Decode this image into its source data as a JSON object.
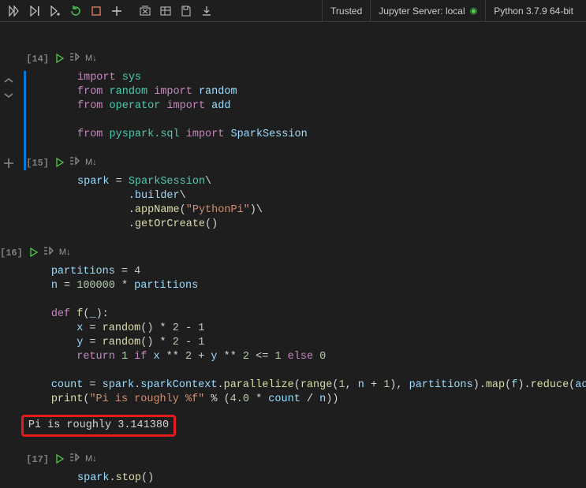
{
  "toolbar": {
    "trusted": "Trusted",
    "server": "Jupyter Server: local",
    "kernel": "Python 3.7.9 64-bit"
  },
  "cells": [
    {
      "prompt": "[14]",
      "code_html": "<span class='kw'>import</span> <span class='mod'>sys</span>\n<span class='kw'>from</span> <span class='mod'>random</span> <span class='kw'>import</span> <span class='id'>random</span>\n<span class='kw'>from</span> <span class='mod'>operator</span> <span class='kw'>import</span> <span class='id'>add</span>\n\n<span class='kw'>from</span> <span class='mod'>pyspark.sql</span> <span class='kw'>import</span> <span class='id'>SparkSession</span>",
      "markdown_label": "M↓"
    },
    {
      "prompt": "[15]",
      "code_html": "<span class='id'>spark</span> = <span class='mod'>SparkSession</span>\\\n        .<span class='id'>builder</span>\\\n        .<span class='fn'>appName</span>(<span class='str'>\"PythonPi\"</span>)\\\n        .<span class='fn'>getOrCreate</span>()",
      "markdown_label": "M↓"
    },
    {
      "prompt": "[16]",
      "code_html": "<span class='id'>partitions</span> = <span class='num'>4</span>\n<span class='id'>n</span> = <span class='num'>100000</span> * <span class='id'>partitions</span>\n\n<span class='kw'>def</span> <span class='fn'>f</span>(<span class='id'>_</span>):\n    <span class='id'>x</span> = <span class='fn'>random</span>() * <span class='num'>2</span> - <span class='num'>1</span>\n    <span class='id'>y</span> = <span class='fn'>random</span>() * <span class='num'>2</span> - <span class='num'>1</span>\n    <span class='kw'>return</span> <span class='num'>1</span> <span class='kw'>if</span> <span class='id'>x</span> ** <span class='num'>2</span> + <span class='id'>y</span> ** <span class='num'>2</span> &lt;= <span class='num'>1</span> <span class='kw'>else</span> <span class='num'>0</span>\n\n<span class='id'>count</span> = <span class='id'>spark</span>.<span class='id'>sparkContext</span>.<span class='fn'>parallelize</span>(<span class='fn'>range</span>(<span class='num'>1</span>, <span class='id'>n</span> + <span class='num'>1</span>), <span class='id'>partitions</span>).<span class='fn'>map</span>(<span class='id'>f</span>).<span class='fn'>reduce</span>(<span class='id'>add</span>)\n<span class='fn'>print</span>(<span class='str'>\"Pi is roughly %f\"</span> % (<span class='num'>4.0</span> * <span class='id'>count</span> / <span class='id'>n</span>))",
      "output": "Pi is roughly 3.141380",
      "markdown_label": "M↓"
    },
    {
      "prompt": "[17]",
      "code_html": "<span class='id'>spark</span>.<span class='fn'>stop</span>()",
      "markdown_label": "M↓"
    }
  ]
}
